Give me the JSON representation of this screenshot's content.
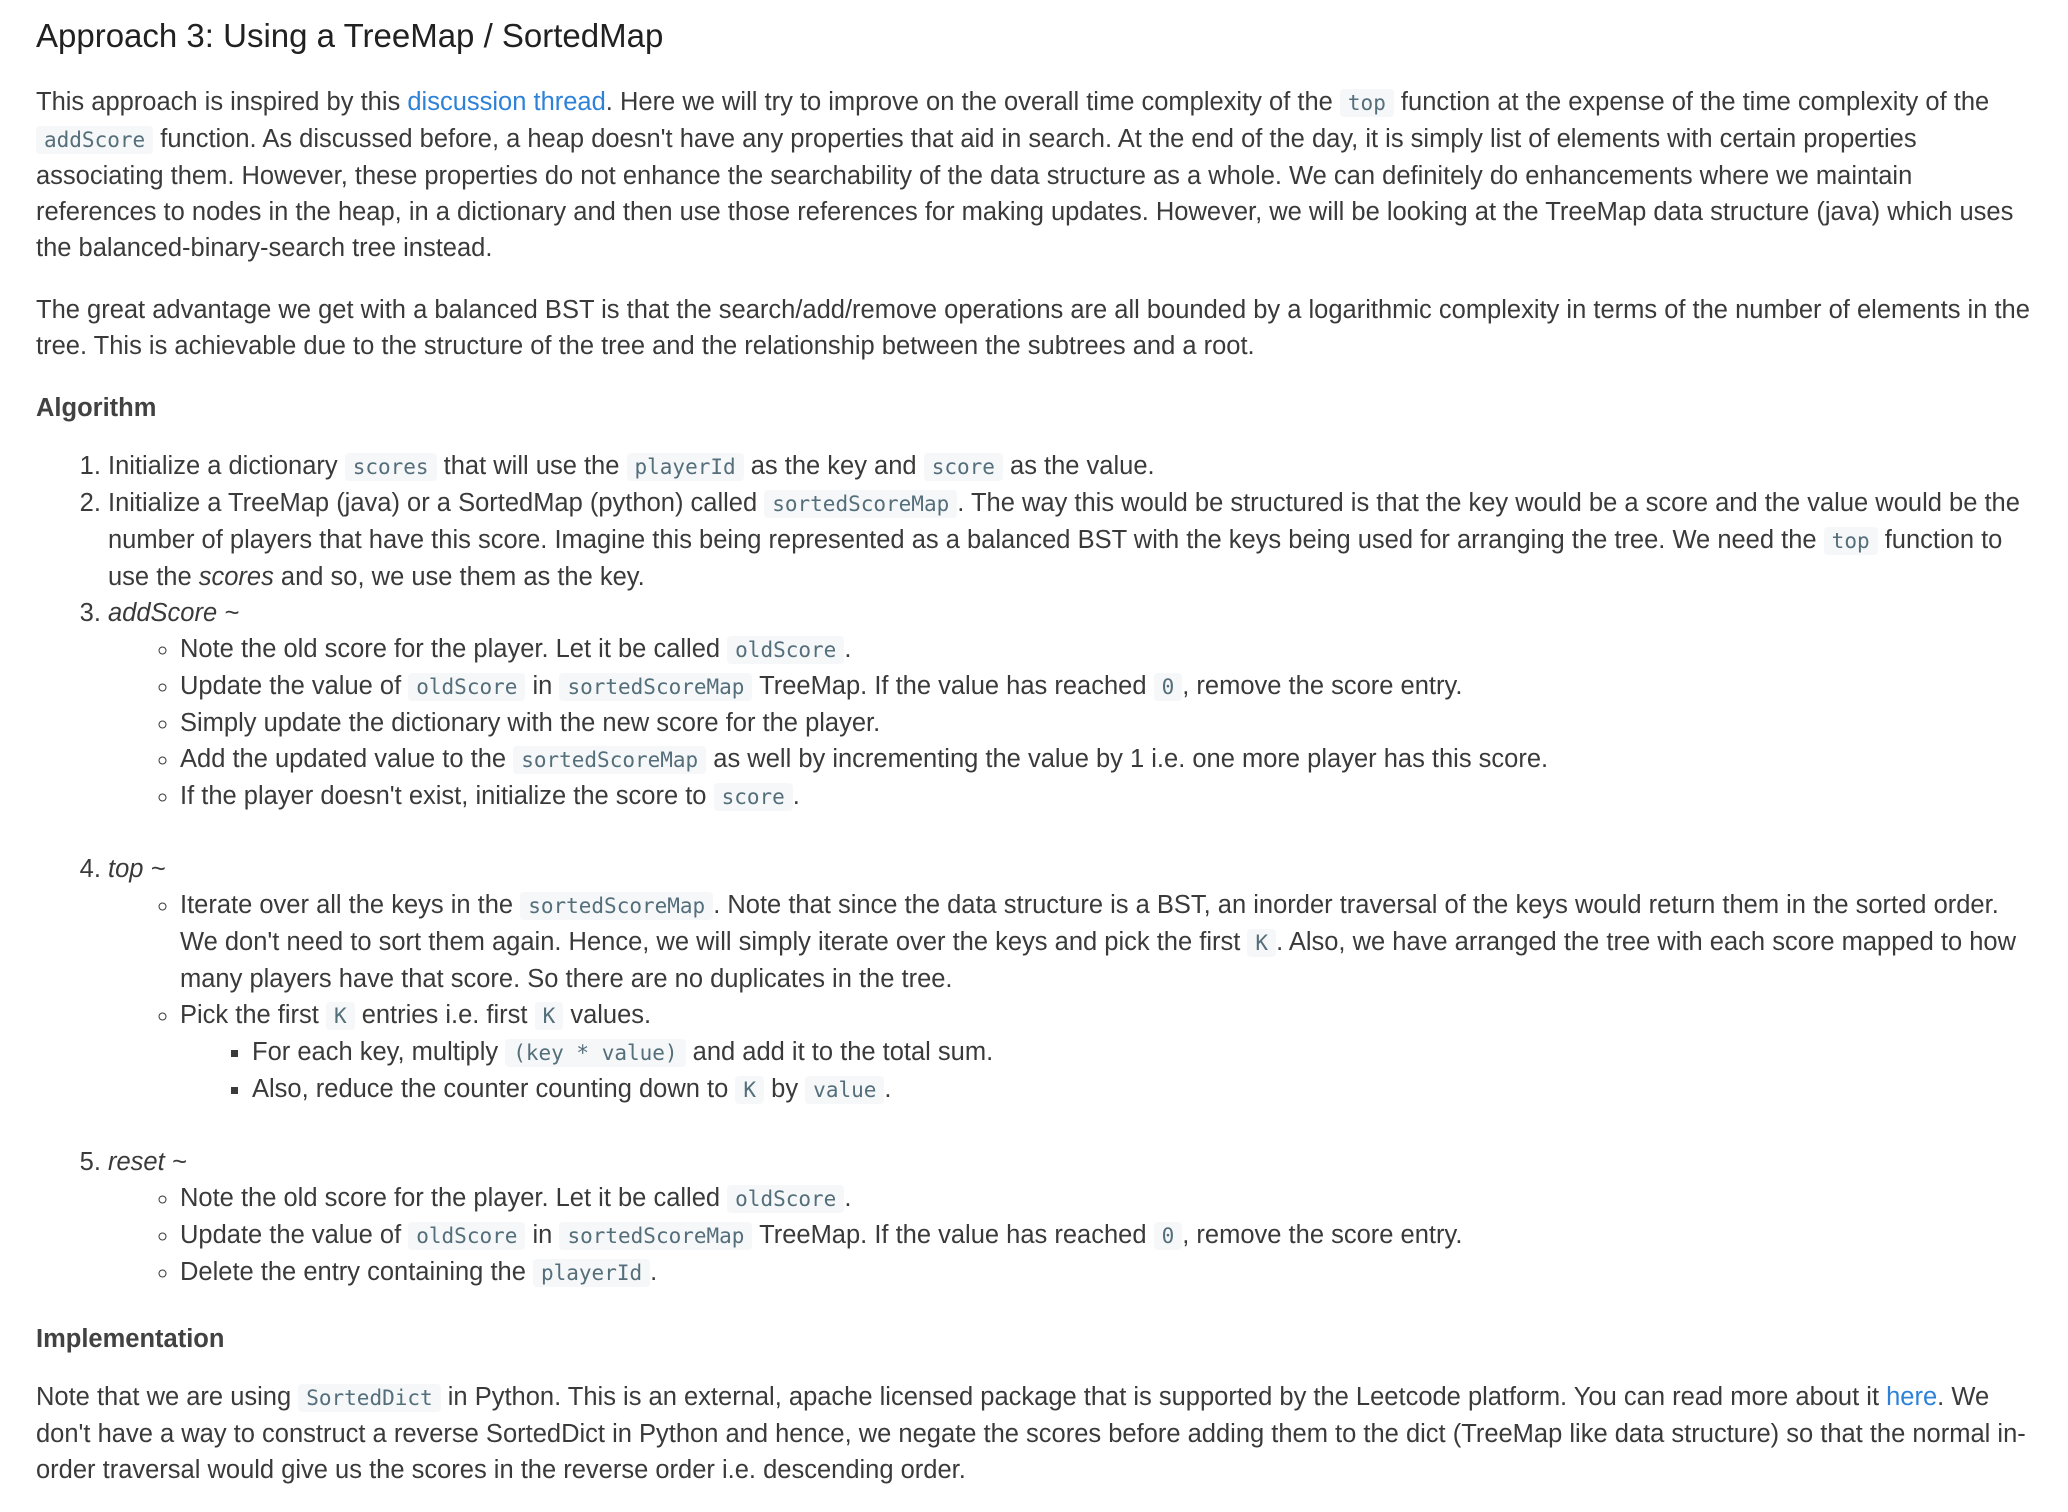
{
  "heading": "Approach 3: Using a TreeMap / SortedMap",
  "intro": {
    "t1": "This approach is inspired by this ",
    "link": "discussion thread",
    "t2": ". Here we will try to improve on the overall time complexity of the ",
    "c1": "top",
    "t3": " function at the expense of the time complexity of the ",
    "c2": "addScore",
    "t4": " function. As discussed before, a heap doesn't have any properties that aid in search. At the end of the day, it is simply list of elements with certain properties associating them. However, these properties do not enhance the searchability of the data structure as a whole. We can definitely do enhancements where we maintain references to nodes in the heap, in a dictionary and then use those references for making updates. However, we will be looking at the TreeMap data structure (java) which uses the balanced-binary-search tree instead."
  },
  "para2": "The great advantage we get with a balanced BST is that the search/add/remove operations are all bounded by a logarithmic complexity in terms of the number of elements in the tree. This is achievable due to the structure of the tree and the relationship between the subtrees and a root.",
  "algorithm_heading": "Algorithm",
  "step1": {
    "t1": "Initialize a dictionary ",
    "c1": "scores",
    "t2": " that will use the ",
    "c2": "playerId",
    "t3": " as the key and ",
    "c3": "score",
    "t4": " as the value."
  },
  "step2": {
    "t1": "Initialize a TreeMap (java) or a SortedMap (python) called ",
    "c1": "sortedScoreMap",
    "t2": ". The way this would be structured is that the key would be a score and the value would be the number of players that have this score. Imagine this being represented as a balanced BST with the keys being used for arranging the tree. We need the ",
    "c2": "top",
    "t3": " function to use the ",
    "em": "scores",
    "t4": " and so, we use them as the key."
  },
  "step3": {
    "title": "addScore ~",
    "b1": {
      "t1": "Note the old score for the player. Let it be called ",
      "c1": "oldScore",
      "t2": "."
    },
    "b2": {
      "t1": "Update the value of ",
      "c1": "oldScore",
      "t2": " in ",
      "c2": "sortedScoreMap",
      "t3": " TreeMap. If the value has reached ",
      "c3": "0",
      "t4": ", remove the score entry."
    },
    "b3": {
      "t1": "Simply update the dictionary with the new score for the player."
    },
    "b4": {
      "t1": "Add the updated value to the ",
      "c1": "sortedScoreMap",
      "t2": " as well by incrementing the value by 1 i.e. one more player has this score."
    },
    "b5": {
      "t1": "If the player doesn't exist, initialize the score to ",
      "c1": "score",
      "t2": "."
    }
  },
  "step4": {
    "title": "top ~",
    "b1": {
      "t1": "Iterate over all the keys in the ",
      "c1": "sortedScoreMap",
      "t2": ". Note that since the data structure is a BST, an inorder traversal of the keys would return them in the sorted order. We don't need to sort them again. Hence, we will simply iterate over the keys and pick the first ",
      "c2": "K",
      "t3": ". Also, we have arranged the tree with each score mapped to how many players have that score. So there are no duplicates in the tree."
    },
    "b2": {
      "t1": "Pick the first ",
      "c1": "K",
      "t2": " entries i.e. first ",
      "c2": "K",
      "t3": " values."
    },
    "b2a": {
      "t1": "For each key, multiply ",
      "c1": "(key * value)",
      "t2": " and add it to the total sum."
    },
    "b2b": {
      "t1": "Also, reduce the counter counting down to ",
      "c1": "K",
      "t2": " by ",
      "c2": "value",
      "t3": "."
    }
  },
  "step5": {
    "title": "reset ~",
    "b1": {
      "t1": "Note the old score for the player. Let it be called ",
      "c1": "oldScore",
      "t2": "."
    },
    "b2": {
      "t1": "Update the value of ",
      "c1": "oldScore",
      "t2": " in ",
      "c2": "sortedScoreMap",
      "t3": " TreeMap. If the value has reached ",
      "c3": "0",
      "t4": ", remove the score entry."
    },
    "b3": {
      "t1": "Delete the entry containing the ",
      "c1": "playerId",
      "t2": "."
    }
  },
  "implementation_heading": "Implementation",
  "impl": {
    "t1": "Note that we are using ",
    "c1": "SortedDict",
    "t2": " in Python. This is an external, apache licensed package that is supported by the Leetcode platform. You can read more about it ",
    "link": "here",
    "t3": ". We don't have a way to construct a reverse SortedDict in Python and hence, we negate the scores before adding them to the dict (TreeMap like data structure) so that the normal in-order traversal would give us the scores in the reverse order i.e. descending order."
  },
  "colors": {
    "link": "#2d82d8",
    "code_bg": "#f5f7f9",
    "code_text": "#546e7a",
    "text": "#3a3a3a"
  }
}
